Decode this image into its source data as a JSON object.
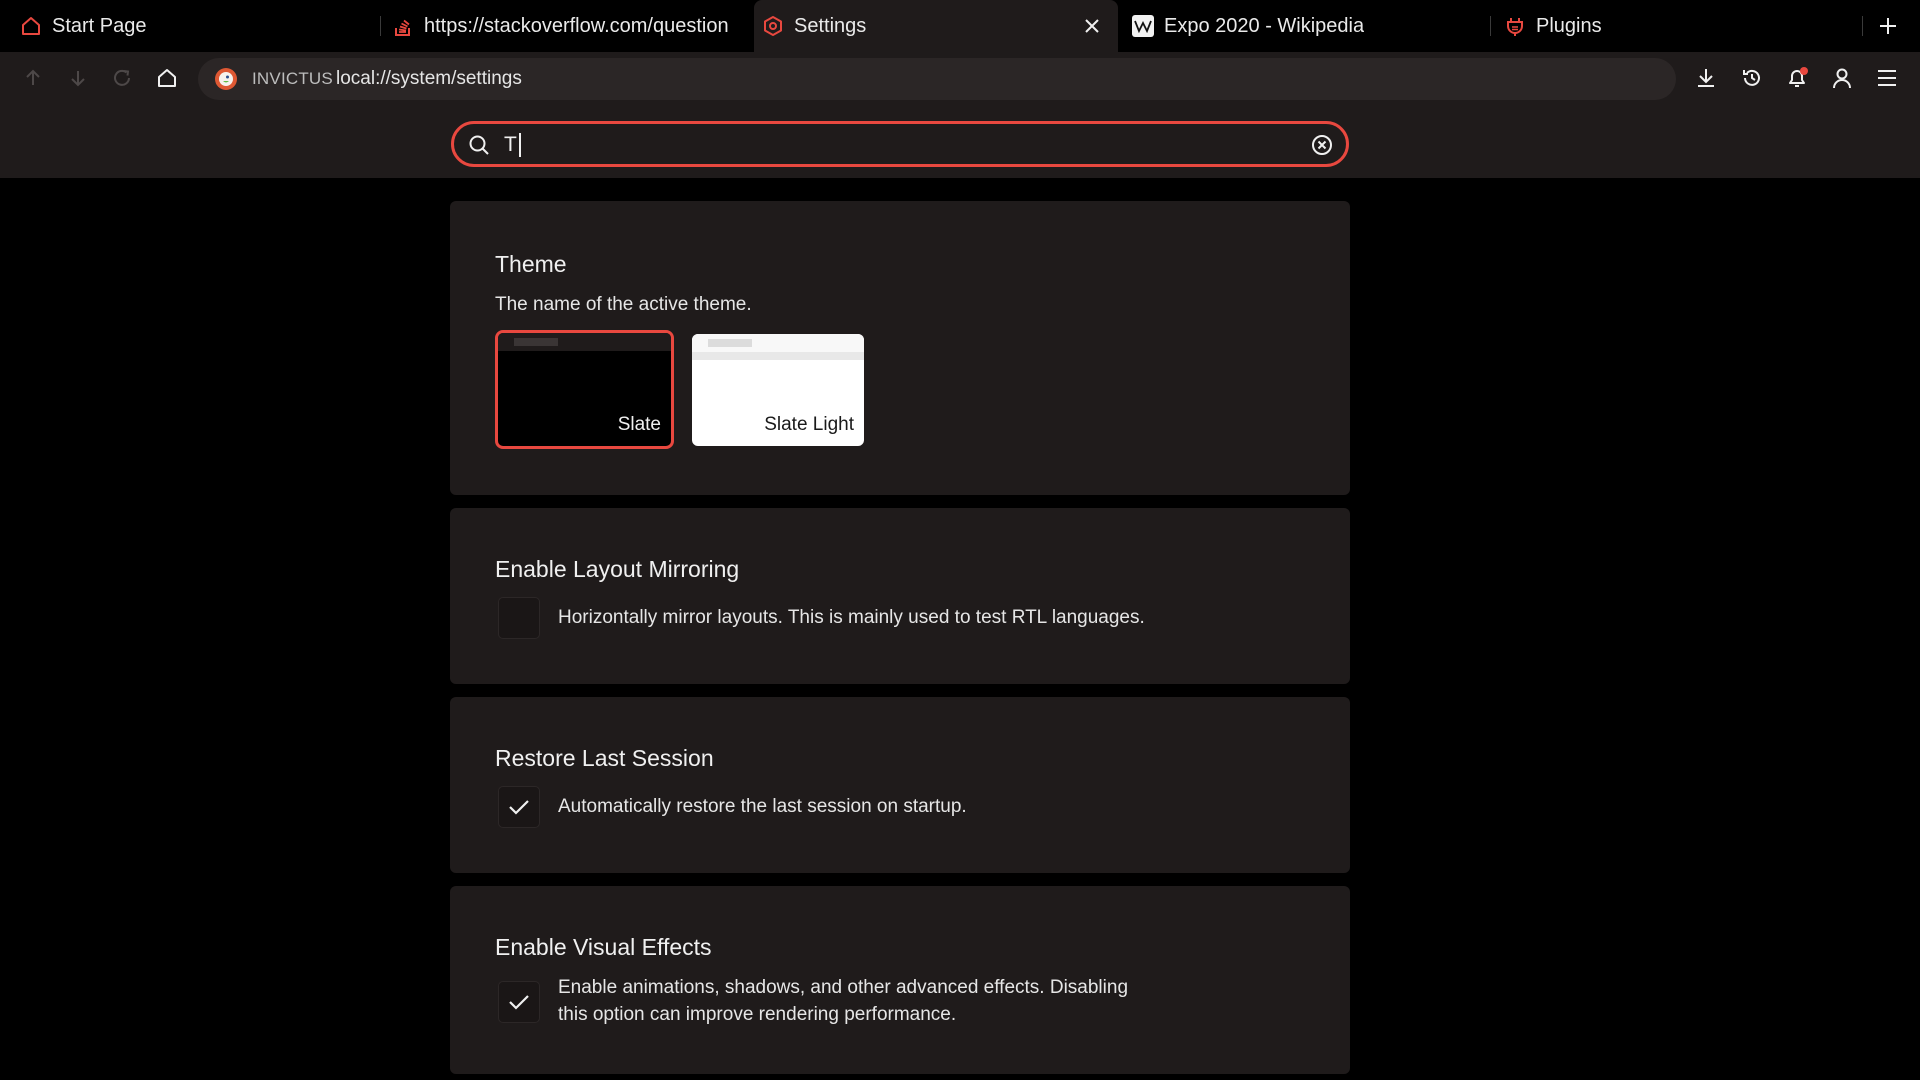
{
  "tabs": [
    {
      "label": "Start Page",
      "icon": "home-icon"
    },
    {
      "label": "https://stackoverflow.com/question",
      "icon": "stackoverflow-icon"
    },
    {
      "label": "Settings",
      "icon": "settings-icon",
      "active": true
    },
    {
      "label": "Expo 2020 - Wikipedia",
      "icon": "wikipedia-icon"
    },
    {
      "label": "Plugins",
      "icon": "plugin-icon"
    }
  ],
  "address_bar": {
    "site_name": "INVICTUS",
    "url": "local://system/settings"
  },
  "search": {
    "value": "T"
  },
  "settings": {
    "theme": {
      "title": "Theme",
      "description": "The name of the active theme.",
      "options": [
        {
          "label": "Slate",
          "selected": true
        },
        {
          "label": "Slate Light",
          "selected": false
        }
      ]
    },
    "layout_mirroring": {
      "title": "Enable Layout Mirroring",
      "description": "Horizontally mirror layouts. This is mainly used to test RTL languages.",
      "checked": false
    },
    "restore_session": {
      "title": "Restore Last Session",
      "description": "Automatically restore the last session on startup.",
      "checked": true
    },
    "visual_effects": {
      "title": "Enable Visual Effects",
      "description_line1": "Enable animations, shadows, and other advanced effects. Disabling",
      "description_line2": "this option can improve rendering performance.",
      "checked": true
    }
  },
  "colors": {
    "accent": "#e8483f",
    "background": "#000000",
    "surface": "#1f1b1b"
  }
}
